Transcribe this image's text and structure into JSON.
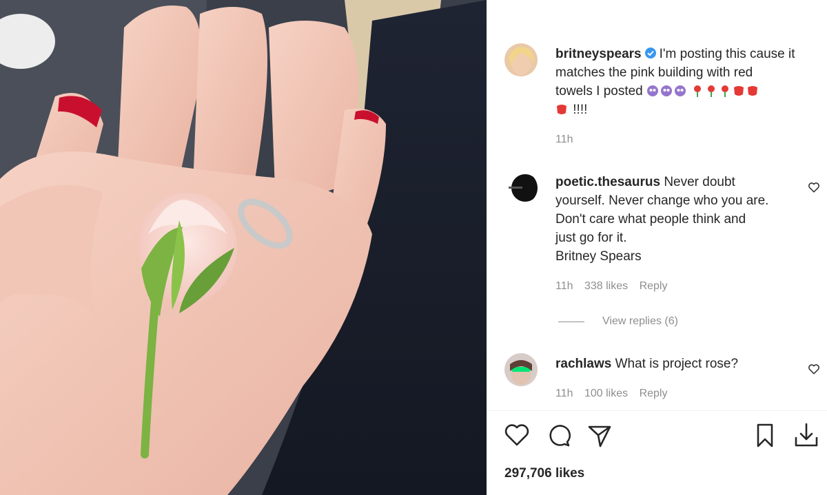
{
  "post": {
    "photo_alt": "",
    "caption": {
      "username": "britneyspears",
      "text_line1": "I'm posting this cause it",
      "text_line2": "matches the pink building with red",
      "text_line3": "towels I posted",
      "text_line4_end": "!!!!",
      "time": "11h"
    }
  },
  "comments": [
    {
      "username": "poetic.thesaurus",
      "lines": [
        "Never doubt",
        "yourself. Never change who you are.",
        "Don't care what people think and",
        "just go for it.",
        "Britney Spears"
      ],
      "time": "11h",
      "likes": "338 likes",
      "reply": "Reply",
      "view_replies": "View replies (6)"
    },
    {
      "username": "rachlaws",
      "text": "What is project rose?",
      "time": "11h",
      "likes": "100 likes",
      "reply": "Reply"
    }
  ],
  "actions": {
    "icons": [
      "heart-icon",
      "comment-icon",
      "share-icon",
      "bookmark-icon",
      "download-icon"
    ]
  },
  "likes_count": "297,706 likes",
  "colors": {
    "verified": "#3897f0",
    "text": "#262626",
    "muted": "#8e8e8e"
  }
}
